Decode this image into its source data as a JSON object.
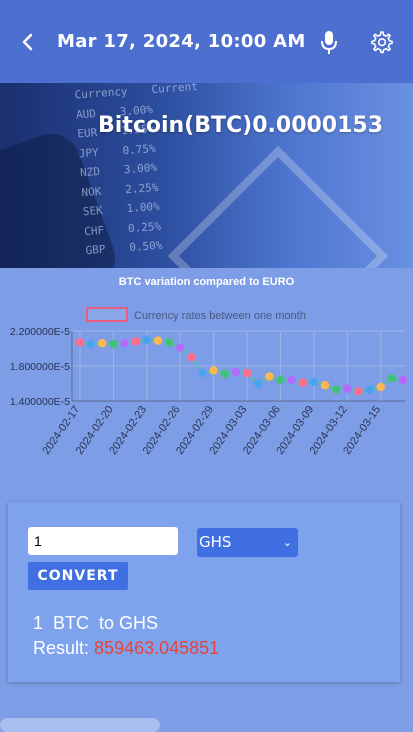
{
  "header": {
    "title": "Mar 17, 2024, 10:00 AM",
    "back_icon": "chevron-left-icon",
    "mic_icon": "microphone-icon",
    "settings_icon": "gear-icon"
  },
  "banner": {
    "title": "Bitcoin(BTC)0.0000153",
    "background_table": [
      [
        "Currency",
        "Current"
      ],
      [
        "AUD",
        "3.00%"
      ],
      [
        "EUR",
        "1.25%"
      ],
      [
        "JPY",
        "0.75%"
      ],
      [
        "NZD",
        "3.00%"
      ],
      [
        "NOK",
        "2.25%"
      ],
      [
        "SEK",
        "1.00%"
      ],
      [
        "CHF",
        "0.25%"
      ],
      [
        "GBP",
        "0.50%"
      ]
    ]
  },
  "chart_data": {
    "type": "line",
    "title": "BTC variation compared to EURO",
    "legend": {
      "label": "Currency rates between one month",
      "position": "top"
    },
    "ylim": [
      1.4e-06,
      2.2e-06
    ],
    "y_ticks": [
      "2.200000E-5",
      "1.800000E-5",
      "1.400000E-5"
    ],
    "x_tick_labels": [
      "2024-02-17",
      "2024-02-20",
      "2024-02-23",
      "2024-02-26",
      "2024-02-29",
      "2024-03-03",
      "2024-03-06",
      "2024-03-09",
      "2024-03-12",
      "2024-03-15"
    ],
    "x": [
      "2024-02-17",
      "2024-02-18",
      "2024-02-19",
      "2024-02-20",
      "2024-02-21",
      "2024-02-22",
      "2024-02-23",
      "2024-02-24",
      "2024-02-25",
      "2024-02-26",
      "2024-02-27",
      "2024-02-28",
      "2024-02-29",
      "2024-03-01",
      "2024-03-02",
      "2024-03-03",
      "2024-03-04",
      "2024-03-05",
      "2024-03-06",
      "2024-03-07",
      "2024-03-08",
      "2024-03-09",
      "2024-03-10",
      "2024-03-11",
      "2024-03-12",
      "2024-03-13",
      "2024-03-14",
      "2024-03-15",
      "2024-03-16"
    ],
    "series": [
      {
        "values": [
          2.07e-06,
          2.05e-06,
          2.06e-06,
          2.05e-06,
          2.06e-06,
          2.08e-06,
          2.1e-06,
          2.09e-06,
          2.07e-06,
          2.01e-06,
          1.9e-06,
          1.72e-06,
          1.75e-06,
          1.71e-06,
          1.73e-06,
          1.72e-06,
          1.6e-06,
          1.68e-06,
          1.64e-06,
          1.64e-06,
          1.61e-06,
          1.62e-06,
          1.58e-06,
          1.53e-06,
          1.54e-06,
          1.51e-06,
          1.53e-06,
          1.56e-06,
          1.66e-06,
          1.64e-06
        ]
      }
    ],
    "point_colors": [
      "#ff6b8a",
      "#4aa3f0",
      "#ffb84d",
      "#45c07a",
      "#b36bff"
    ],
    "grid": true
  },
  "converter": {
    "amount_value": "1",
    "currency_selected": "GHS",
    "convert_label": "CONVERT",
    "result_line": "1  BTC  to GHS",
    "result_label": "Result:",
    "result_value": "859463.045851"
  }
}
